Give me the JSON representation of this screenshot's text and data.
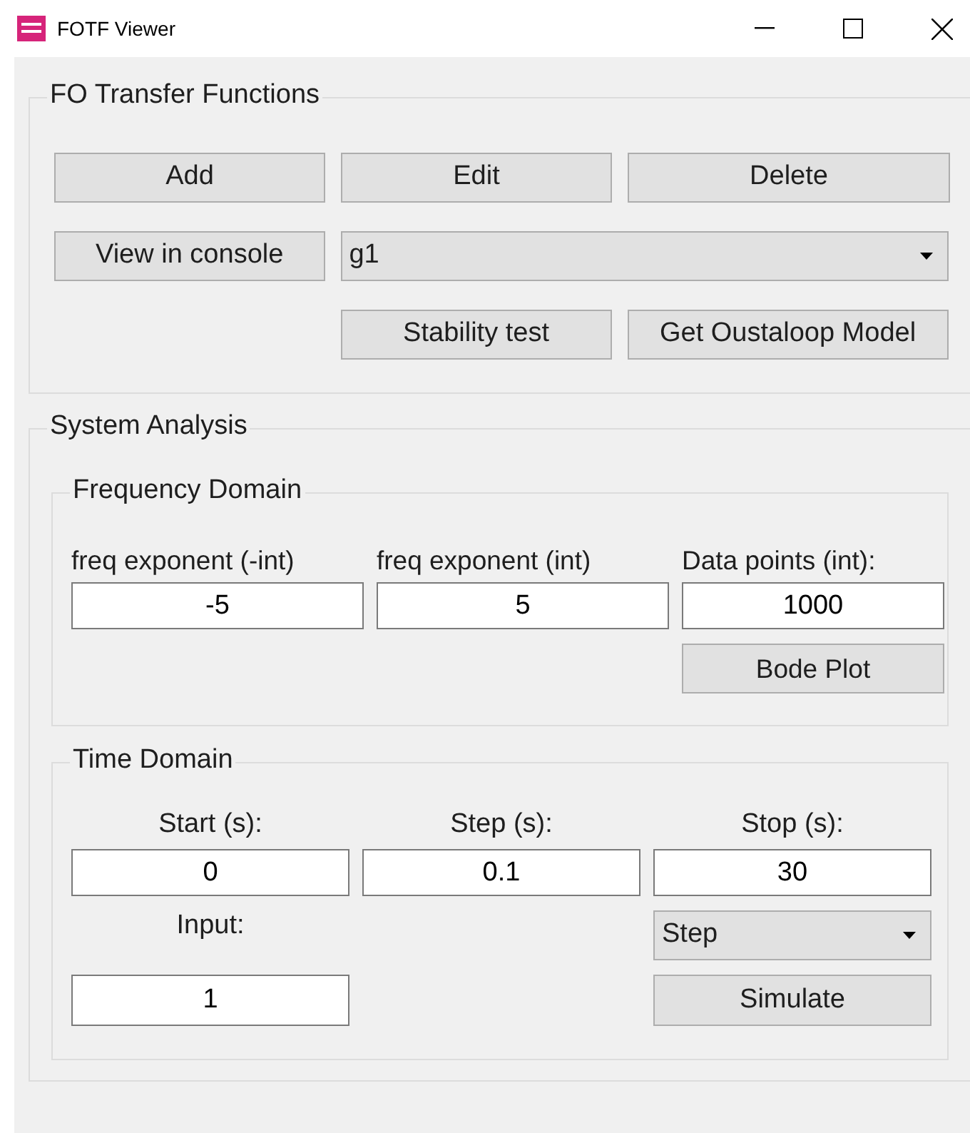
{
  "window": {
    "title": "FOTF Viewer"
  },
  "transfer_functions": {
    "title": "FO Transfer Functions",
    "buttons": [
      "Add",
      "Edit",
      "Delete"
    ],
    "view_button": "View in console",
    "selector": {
      "value": "g1"
    },
    "stability_button": "Stability test",
    "oustaloop_button": "Get Oustaloop Model"
  },
  "system_analysis": {
    "title": "System Analysis",
    "frequency_domain": {
      "title": "Frequency Domain",
      "fields": [
        {
          "label": "freq exponent (-int)",
          "value": "-5"
        },
        {
          "label": "freq exponent (int)",
          "value": "5"
        },
        {
          "label": "Data points (int):",
          "value": "1000"
        }
      ],
      "button": "Bode Plot"
    },
    "time_domain": {
      "title": "Time Domain",
      "fields": [
        {
          "label": "Start (s):",
          "value": "0"
        },
        {
          "label": "Step (s):",
          "value": "0.1"
        },
        {
          "label": "Stop (s):",
          "value": "30"
        }
      ],
      "input_label": "Input:",
      "input_value": "1",
      "signal": {
        "value": "Step"
      },
      "button": "Simulate"
    }
  }
}
